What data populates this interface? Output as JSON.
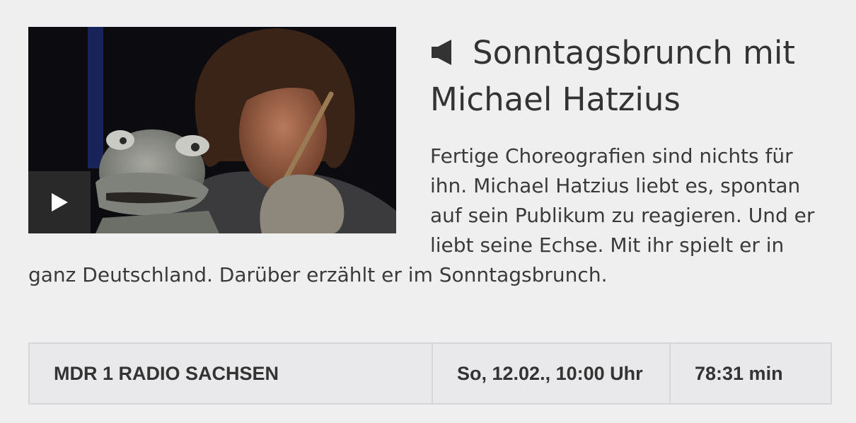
{
  "teaser": {
    "headline": "Sonntagsbrunch mit Michael Hatzius",
    "text": "Fertige Choreografien sind nichts für ihn. Michael Hatzius liebt es, spontan auf sein Publikum zu reagieren. Und er liebt seine Echse. Mit ihr spielt er in ganz Deutschland. Darüber erzählt er im Sonntagsbrunch.",
    "media_type_icon": "speaker-icon",
    "play_icon": "play-icon"
  },
  "meta": {
    "station": "MDR 1 RADIO SACHSEN",
    "date": "So, 12.02., 10:00 Uhr",
    "duration": "78:31 min"
  }
}
